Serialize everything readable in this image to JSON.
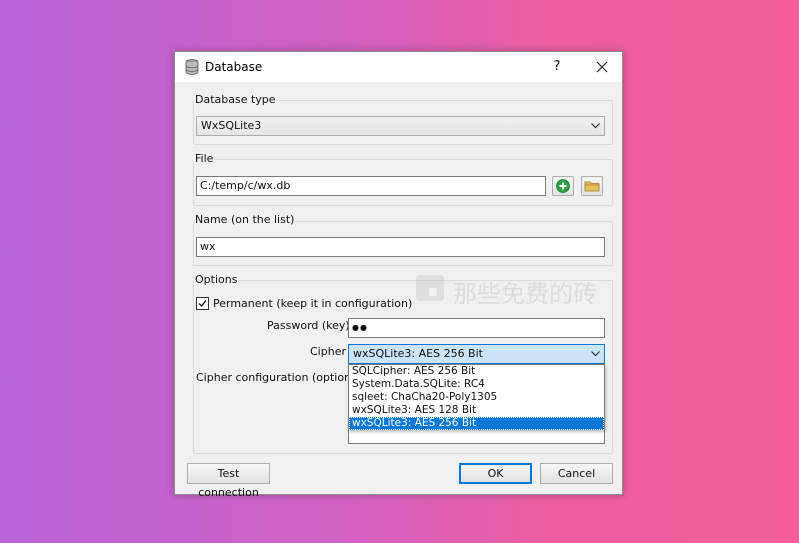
{
  "window": {
    "title": "Database",
    "help_label": "?"
  },
  "database_type": {
    "group_label": "Database type",
    "selected": "WxSQLite3"
  },
  "file": {
    "group_label": "File",
    "value": "C:/temp/c/wx.db"
  },
  "name": {
    "group_label": "Name (on the list)",
    "value": "wx"
  },
  "options": {
    "group_label": "Options",
    "permanent_label": "Permanent (keep it in configuration)",
    "permanent_checked": true,
    "password_label": "Password (key)",
    "password_value": "●●",
    "cipher_label": "Cipher",
    "cipher_selected": "wxSQLite3: AES 256 Bit",
    "cipher_options": [
      "SQLCipher: AES 256 Bit",
      "System.Data.SQLite: RC4",
      "sqleet: ChaCha20-Poly1305",
      "wxSQLite3: AES 128 Bit",
      "wxSQLite3: AES 256 Bit"
    ],
    "cipher_config_label": "Cipher configuration (optional)"
  },
  "buttons": {
    "test_connection": "Test connection",
    "ok": "OK",
    "cancel": "Cancel"
  },
  "watermark": "那些免费的砖",
  "colors": {
    "selection": "#0078d7",
    "add_icon": "#2ea043",
    "folder_icon": "#e8c15a"
  }
}
